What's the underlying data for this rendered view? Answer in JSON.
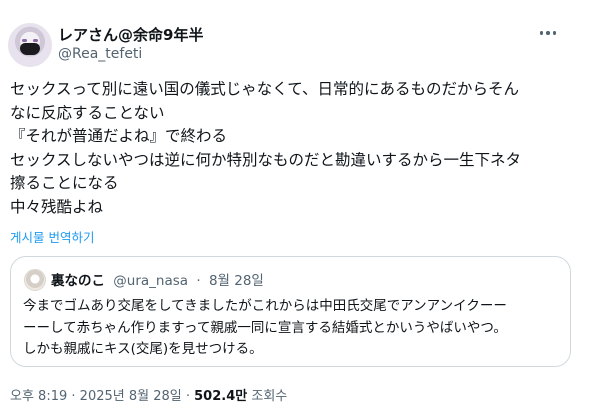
{
  "author": {
    "display_name": "レアさん@余命9年半",
    "handle": "@Rea_tefeti"
  },
  "tweet": {
    "lines": [
      "セックスって別に遠い国の儀式じゃなくて、日常的にあるものだからそん",
      "なに反応することない",
      "『それが普通だよね』で終わる",
      "セックスしないやつは逆に何か特別なものだと勘違いするから一生下ネタ",
      "擦ることになる",
      "中々残酷よね"
    ],
    "translate_label": "게시물 번역하기"
  },
  "quote": {
    "name": "裏なのこ",
    "handle": "@ura_nasa",
    "separator": "·",
    "date": "8월 28일",
    "lines": [
      "今までゴムあり交尾をしてきましたがこれからは中田氏交尾でアンアンイクーー",
      "ーーして赤ちゃん作りますって親戚一同に宣言する結婚式とかいうやばいやつ。",
      "しかも親戚にキス(交尾)を見せつける。"
    ]
  },
  "meta": {
    "time": "오후 8:19",
    "separator": "·",
    "date": "2025년 8월 28일",
    "views_count": "502.4만",
    "views_label": "조회수"
  },
  "icons": {
    "more": "more-horizontal-icon"
  }
}
